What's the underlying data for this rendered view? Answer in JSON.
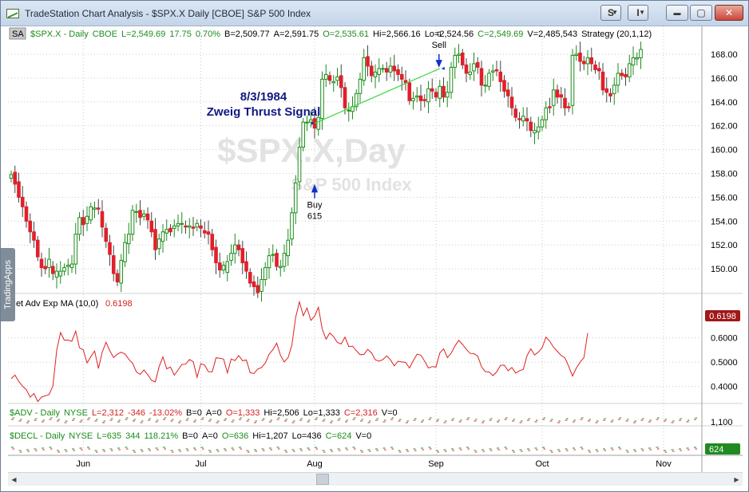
{
  "window": {
    "title": "TradeStation Chart Analysis - $SPX.X Daily [CBOE] S&P 500 Index",
    "symbol_button": "S",
    "indicator_button": "I",
    "dropdown_glyph": "▼",
    "minimize_glyph": "▬",
    "restore_glyph": "▢",
    "close_glyph": "✕"
  },
  "side_tab": {
    "label": "TradingApps"
  },
  "price_panel": {
    "sa_label": "SA",
    "info_items": [
      {
        "text": "$SPX.X - Daily",
        "color": "#1c8c1c"
      },
      {
        "text": "CBOE",
        "color": "#1c8c1c"
      },
      {
        "text": "L=2,549.69",
        "color": "#1c8c1c"
      },
      {
        "text": "17.75",
        "color": "#1c8c1c"
      },
      {
        "text": "0.70%",
        "color": "#1c8c1c"
      },
      {
        "text": "B=2,509.77",
        "color": "#000000"
      },
      {
        "text": "A=2,591.75",
        "color": "#000000"
      },
      {
        "text": "O=2,535.61",
        "color": "#1c8c1c"
      },
      {
        "text": "Hi=2,566.16",
        "color": "#000000"
      },
      {
        "text": "Lo=2,524.56",
        "color": "#000000"
      },
      {
        "text": "C=2,549.69",
        "color": "#1c8c1c"
      },
      {
        "text": "V=2,485,543",
        "color": "#000000"
      },
      {
        "text": "Strategy (20,1,12)",
        "color": "#000000"
      }
    ],
    "watermark_symbol": "$SPX.X,Day",
    "watermark_name": "S&P 500 Index",
    "annotation_date": "8/3/1984",
    "annotation_title": "Zweig Thrust Signal",
    "buy_label": "Buy",
    "buy_qty": "615",
    "sell_label": "Sell",
    "sell_qty": "0",
    "y_ticks": [
      "168.00",
      "166.00",
      "164.00",
      "162.00",
      "160.00",
      "158.00",
      "156.00",
      "154.00",
      "152.00",
      "150.00"
    ]
  },
  "indicator_panel": {
    "label": "Net Adv Exp MA (10,0)",
    "value": "0.6198",
    "last_value_badge": "0.6198",
    "y_ticks": [
      "0.6000",
      "0.5000",
      "0.4000"
    ]
  },
  "adv_panel": {
    "info_items": [
      {
        "text": "$ADV - Daily",
        "color": "#1c8c1c"
      },
      {
        "text": "NYSE",
        "color": "#1c8c1c"
      },
      {
        "text": "L=2,312",
        "color": "#d42020"
      },
      {
        "text": "-346",
        "color": "#d42020"
      },
      {
        "text": "-13.02%",
        "color": "#d42020"
      },
      {
        "text": "B=0",
        "color": "#000000"
      },
      {
        "text": "A=0",
        "color": "#000000"
      },
      {
        "text": "O=1,333",
        "color": "#d42020"
      },
      {
        "text": "Hi=2,506",
        "color": "#000000"
      },
      {
        "text": "Lo=1,333",
        "color": "#000000"
      },
      {
        "text": "C=2,316",
        "color": "#d42020"
      },
      {
        "text": "V=0",
        "color": "#000000"
      }
    ],
    "axis_label": "1,100"
  },
  "decl_panel": {
    "info_items": [
      {
        "text": "$DECL - Daily",
        "color": "#1c8c1c"
      },
      {
        "text": "NYSE",
        "color": "#1c8c1c"
      },
      {
        "text": "L=635",
        "color": "#1c8c1c"
      },
      {
        "text": "344",
        "color": "#1c8c1c"
      },
      {
        "text": "118.21%",
        "color": "#1c8c1c"
      },
      {
        "text": "B=0",
        "color": "#000000"
      },
      {
        "text": "A=0",
        "color": "#000000"
      },
      {
        "text": "O=636",
        "color": "#1c8c1c"
      },
      {
        "text": "Hi=1,207",
        "color": "#000000"
      },
      {
        "text": "Lo=436",
        "color": "#000000"
      },
      {
        "text": "C=624",
        "color": "#1c8c1c"
      },
      {
        "text": "V=0",
        "color": "#000000"
      }
    ],
    "last_value_badge": "624"
  },
  "time_axis": {
    "labels": [
      {
        "text": "Jun",
        "day": 19
      },
      {
        "text": "Jul",
        "day": 50
      },
      {
        "text": "Aug",
        "day": 80
      },
      {
        "text": "Sep",
        "day": 112
      },
      {
        "text": "Oct",
        "day": 140
      },
      {
        "text": "Nov",
        "day": 172
      }
    ]
  },
  "scrollbar": {
    "left_arrow": "◀",
    "right_arrow": "▶"
  },
  "colors": {
    "up": "#1c8c1c",
    "down": "#e0202a",
    "indicator": "#e02020",
    "annotation": "#101880",
    "trade_line": "#3cd83c",
    "arrow": "#1030c8",
    "badge_red": "#a01818",
    "badge_green": "#208a20"
  },
  "chart_data": {
    "type": "candlestick",
    "price": {
      "first_day": 0,
      "open_close": [
        [
          157.6,
          157.9
        ],
        [
          158.1,
          157.1
        ],
        [
          157.3,
          156.0
        ],
        [
          156.0,
          155.2
        ],
        [
          155.2,
          154.0
        ],
        [
          154.0,
          153.1
        ],
        [
          153.1,
          152.4
        ],
        [
          152.4,
          151.0
        ],
        [
          150.8,
          150.1
        ],
        [
          150.2,
          150.0
        ],
        [
          150.1,
          150.8
        ],
        [
          150.2,
          149.6
        ],
        [
          149.3,
          149.8
        ],
        [
          149.4,
          149.8
        ],
        [
          149.8,
          150.1
        ],
        [
          150.2,
          150.3
        ],
        [
          150.1,
          150.4
        ],
        [
          150.4,
          152.9
        ],
        [
          152.9,
          154.3
        ],
        [
          154.3,
          153.7
        ],
        [
          153.8,
          154.4
        ],
        [
          154.1,
          155.2
        ],
        [
          155.0,
          155.1
        ],
        [
          155.1,
          155.0
        ],
        [
          154.8,
          153.5
        ],
        [
          153.4,
          152.3
        ],
        [
          152.2,
          151.2
        ],
        [
          151.1,
          149.6
        ],
        [
          149.6,
          148.9
        ],
        [
          148.8,
          150.7
        ],
        [
          150.6,
          152.2
        ],
        [
          152.1,
          152.9
        ],
        [
          152.9,
          154.9
        ],
        [
          154.8,
          154.8
        ],
        [
          154.9,
          154.3
        ],
        [
          154.4,
          154.6
        ],
        [
          154.6,
          154.1
        ],
        [
          154.0,
          153.1
        ],
        [
          153.3,
          151.6
        ],
        [
          151.7,
          152.5
        ],
        [
          152.3,
          153.1
        ],
        [
          153.0,
          153.3
        ],
        [
          153.4,
          153.1
        ],
        [
          153.4,
          153.6
        ],
        [
          153.6,
          153.8
        ],
        [
          153.8,
          153.8
        ],
        [
          153.6,
          153.5
        ],
        [
          153.5,
          153.6
        ],
        [
          153.5,
          153.4
        ],
        [
          153.5,
          153.8
        ],
        [
          153.6,
          153.4
        ],
        [
          153.2,
          153.0
        ],
        [
          153.1,
          152.9
        ],
        [
          152.9,
          151.6
        ],
        [
          151.8,
          150.5
        ],
        [
          150.5,
          149.9
        ],
        [
          149.9,
          150.3
        ],
        [
          149.7,
          150.6
        ],
        [
          150.7,
          151.3
        ],
        [
          151.3,
          152.0
        ],
        [
          152.0,
          151.6
        ],
        [
          151.7,
          150.5
        ],
        [
          150.6,
          149.8
        ],
        [
          149.7,
          148.8
        ],
        [
          148.9,
          148.5
        ],
        [
          148.6,
          148.0
        ],
        [
          148.1,
          149.1
        ],
        [
          149.1,
          150.1
        ],
        [
          150.1,
          151.1
        ],
        [
          151.2,
          151.2
        ],
        [
          151.3,
          150.2
        ],
        [
          150.1,
          150.2
        ],
        [
          150.2,
          151.3
        ],
        [
          151.1,
          152.4
        ],
        [
          152.5,
          154.7
        ],
        [
          154.7,
          157.2
        ],
        [
          157.3,
          160.2
        ],
        [
          160.2,
          162.3
        ],
        [
          162.3,
          162.3
        ],
        [
          162.3,
          162.5
        ],
        [
          162.6,
          161.8
        ],
        [
          161.7,
          162.7
        ],
        [
          162.6,
          165.9
        ],
        [
          165.9,
          166.3
        ],
        [
          166.2,
          165.8
        ],
        [
          165.6,
          165.7
        ],
        [
          165.8,
          166.1
        ],
        [
          166.2,
          165.2
        ],
        [
          165.2,
          163.5
        ],
        [
          163.3,
          163.3
        ],
        [
          163.2,
          163.6
        ],
        [
          163.6,
          164.7
        ],
        [
          164.7,
          165.9
        ],
        [
          165.8,
          167.7
        ],
        [
          167.8,
          167.0
        ],
        [
          167.0,
          166.2
        ],
        [
          166.1,
          166.5
        ],
        [
          166.3,
          166.8
        ],
        [
          166.8,
          166.8
        ],
        [
          166.8,
          166.5
        ],
        [
          166.5,
          167.0
        ],
        [
          167.0,
          166.6
        ],
        [
          166.7,
          166.3
        ],
        [
          166.3,
          165.9
        ],
        [
          165.8,
          165.6
        ],
        [
          165.6,
          164.1
        ],
        [
          164.1,
          164.3
        ],
        [
          164.4,
          164.5
        ],
        [
          164.5,
          164.1
        ],
        [
          164.2,
          164.1
        ],
        [
          164.0,
          165.1
        ],
        [
          165.1,
          164.9
        ],
        [
          164.8,
          164.4
        ],
        [
          164.3,
          165.3
        ],
        [
          165.3,
          164.4
        ],
        [
          164.4,
          164.8
        ],
        [
          164.8,
          166.9
        ],
        [
          166.9,
          167.9
        ],
        [
          167.9,
          168.0
        ],
        [
          168.1,
          167.1
        ],
        [
          167.1,
          166.4
        ],
        [
          166.3,
          166.5
        ],
        [
          166.6,
          167.2
        ],
        [
          167.3,
          166.9
        ],
        [
          166.8,
          165.4
        ],
        [
          165.4,
          165.4
        ],
        [
          165.3,
          166.4
        ],
        [
          166.5,
          166.6
        ],
        [
          166.7,
          166.6
        ],
        [
          166.5,
          165.7
        ],
        [
          165.8,
          164.9
        ],
        [
          165.0,
          164.5
        ],
        [
          164.4,
          163.5
        ],
        [
          163.4,
          162.7
        ],
        [
          162.6,
          162.5
        ],
        [
          162.4,
          162.8
        ],
        [
          162.6,
          162.4
        ],
        [
          162.3,
          161.6
        ],
        [
          161.4,
          161.6
        ],
        [
          161.5,
          161.9
        ],
        [
          161.9,
          162.5
        ],
        [
          162.5,
          163.5
        ],
        [
          163.6,
          163.5
        ],
        [
          163.7,
          165.0
        ],
        [
          165.0,
          164.4
        ],
        [
          164.6,
          164.4
        ],
        [
          164.3,
          163.5
        ],
        [
          163.6,
          163.5
        ],
        [
          163.7,
          167.9
        ],
        [
          167.9,
          168.0
        ],
        [
          168.1,
          167.4
        ],
        [
          167.4,
          167.2
        ],
        [
          167.2,
          167.7
        ],
        [
          167.7,
          167.2
        ],
        [
          167.1,
          166.7
        ],
        [
          166.8,
          166.6
        ],
        [
          166.5,
          165.0
        ],
        [
          165.1,
          164.8
        ],
        [
          164.7,
          164.5
        ],
        [
          164.7,
          165.4
        ],
        [
          165.4,
          166.4
        ],
        [
          166.4,
          166.2
        ],
        [
          166.3,
          166.1
        ],
        [
          166.1,
          167.2
        ],
        [
          167.1,
          167.7
        ],
        [
          167.6,
          167.7
        ],
        [
          167.7,
          168.4
        ]
      ],
      "trade_entry": {
        "day": 80,
        "price": 162.2
      },
      "trade_exit": {
        "day": 113,
        "price": 166.8
      },
      "y_range": [
        148,
        169
      ]
    },
    "indicator": {
      "first_day": 0,
      "values": [
        0.432,
        0.447,
        0.421,
        0.401,
        0.387,
        0.356,
        0.371,
        0.338,
        0.356,
        0.362,
        0.367,
        0.403,
        0.549,
        0.622,
        0.591,
        0.591,
        0.586,
        0.628,
        0.559,
        0.551,
        0.497,
        0.523,
        0.546,
        0.474,
        0.541,
        0.582,
        0.547,
        0.519,
        0.533,
        0.541,
        0.534,
        0.512,
        0.496,
        0.46,
        0.45,
        0.468,
        0.449,
        0.425,
        0.419,
        0.482,
        0.522,
        0.473,
        0.48,
        0.447,
        0.468,
        0.491,
        0.492,
        0.511,
        0.502,
        0.438,
        0.494,
        0.488,
        0.461,
        0.46,
        0.518,
        0.516,
        0.513,
        0.456,
        0.513,
        0.507,
        0.527,
        0.506,
        0.509,
        0.457,
        0.453,
        0.472,
        0.478,
        0.497,
        0.533,
        0.552,
        0.578,
        0.528,
        0.501,
        0.519,
        0.57,
        0.685,
        0.748,
        0.691,
        0.723,
        0.672,
        0.689,
        0.726,
        0.637,
        0.595,
        0.62,
        0.605,
        0.581,
        0.575,
        0.603,
        0.564,
        0.566,
        0.547,
        0.531,
        0.532,
        0.553,
        0.538,
        0.51,
        0.504,
        0.511,
        0.526,
        0.51,
        0.485,
        0.504,
        0.501,
        0.499,
        0.476,
        0.506,
        0.533,
        0.529,
        0.504,
        0.476,
        0.482,
        0.48,
        0.538,
        0.555,
        0.519,
        0.537,
        0.567,
        0.59,
        0.573,
        0.553,
        0.536,
        0.535,
        0.525,
        0.481,
        0.461,
        0.46,
        0.445,
        0.46,
        0.487,
        0.488,
        0.465,
        0.478,
        0.455,
        0.465,
        0.47,
        0.527,
        0.555,
        0.53,
        0.542,
        0.56,
        0.603,
        0.586,
        0.561,
        0.545,
        0.527,
        0.518,
        0.482,
        0.443,
        0.476,
        0.5,
        0.519,
        0.6198
      ],
      "y_range": [
        0.34,
        0.75
      ]
    },
    "adv_decl": {
      "adv_range": [
        600,
        1600
      ],
      "decl_range": [
        300,
        1300
      ]
    },
    "total_days": 182
  }
}
